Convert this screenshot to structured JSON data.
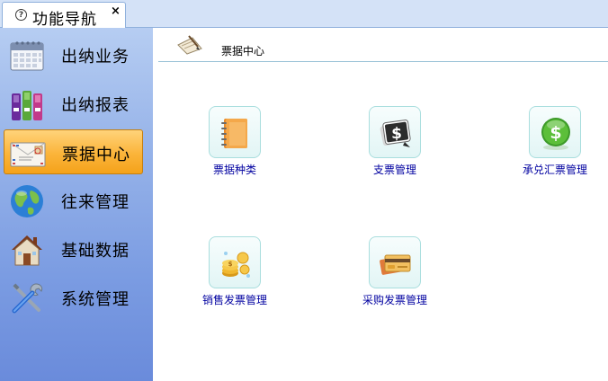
{
  "tab": {
    "title": "功能导航",
    "close": "×"
  },
  "sidebar": {
    "items": [
      {
        "label": "出纳业务",
        "icon": "calendar-icon",
        "active": false
      },
      {
        "label": "出纳报表",
        "icon": "binders-icon",
        "active": false
      },
      {
        "label": "票据中心",
        "icon": "envelope-icon",
        "active": true
      },
      {
        "label": "往来管理",
        "icon": "globe-icon",
        "active": false
      },
      {
        "label": "基础数据",
        "icon": "house-icon",
        "active": false
      },
      {
        "label": "系统管理",
        "icon": "tools-icon",
        "active": false
      }
    ]
  },
  "main": {
    "title": "票据中心",
    "tiles": [
      {
        "label": "票据种类",
        "icon": "notebook-icon"
      },
      {
        "label": "支票管理",
        "icon": "dollar-cheque-icon"
      },
      {
        "label": "承兑汇票管理",
        "icon": "dollar-coin-icon"
      },
      {
        "label": "销售发票管理",
        "icon": "coins-icon"
      },
      {
        "label": "采购发票管理",
        "icon": "cards-icon"
      }
    ]
  },
  "colors": {
    "active_nav": "#fbb43a",
    "tile_label": "#0000a0",
    "sidebar_bottom": "#6a8bdb"
  }
}
